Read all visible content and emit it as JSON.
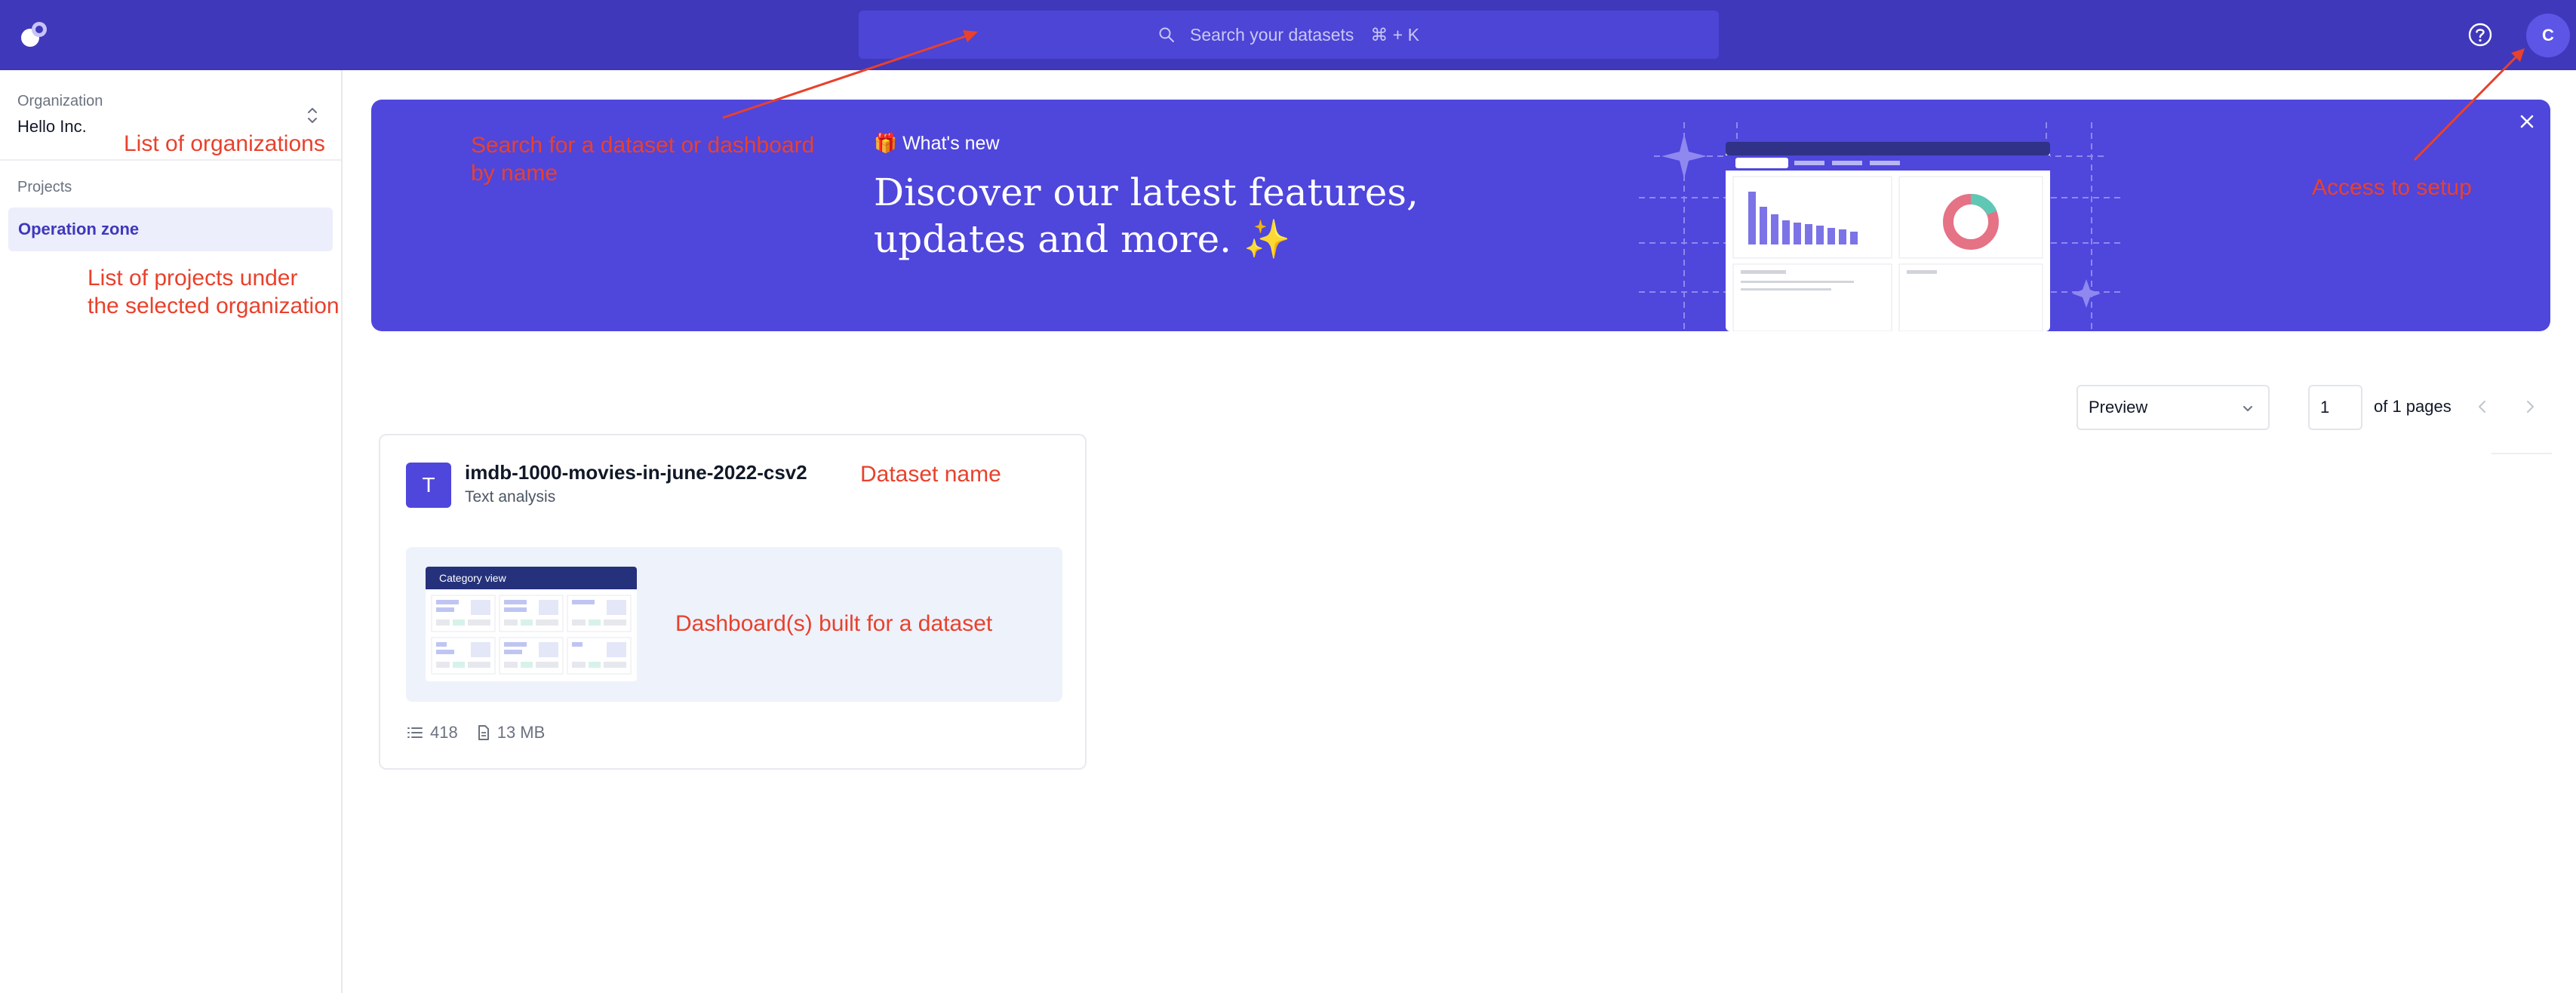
{
  "colors": {
    "topbar": "#3f38bb",
    "banner": "#4f46dc",
    "accent": "#3f38bb",
    "annotation": "#e8412c",
    "selected_bg": "#eceefb"
  },
  "header": {
    "logo_icon": "app-logo-icon",
    "search_placeholder": "Search your datasets",
    "search_shortcut": "⌘ + K",
    "help_icon": "help-circle-icon",
    "avatar_initial": "C"
  },
  "sidebar": {
    "org_label": "Organization",
    "org_name": "Hello Inc.",
    "projects_label": "Projects",
    "projects": [
      {
        "label": "Operation zone",
        "selected": true
      }
    ]
  },
  "banner": {
    "whats_new": "🎁 What's new",
    "headline_line1": "Discover our latest features,",
    "headline_line2": "updates and more. ✨",
    "close_icon": "close-icon"
  },
  "controls": {
    "view_select": "Preview",
    "page_value": "1",
    "of_pages": "of 1 pages"
  },
  "dataset": {
    "initial": "T",
    "name": "imdb-1000-movies-in-june-2022-csv2",
    "type": "Text analysis",
    "dashboard_title": "Category view",
    "rows": "418",
    "size": "13 MB"
  },
  "annotations": {
    "organizations": "List of organizations",
    "search_line1": "Search for a dataset or dashboard",
    "search_line2": "by name",
    "projects_line1": "List of projects under",
    "projects_line2": "the selected organization",
    "setup": "Access to setup",
    "dataset_name": "Dataset name",
    "dashboards": "Dashboard(s) built for a dataset"
  }
}
